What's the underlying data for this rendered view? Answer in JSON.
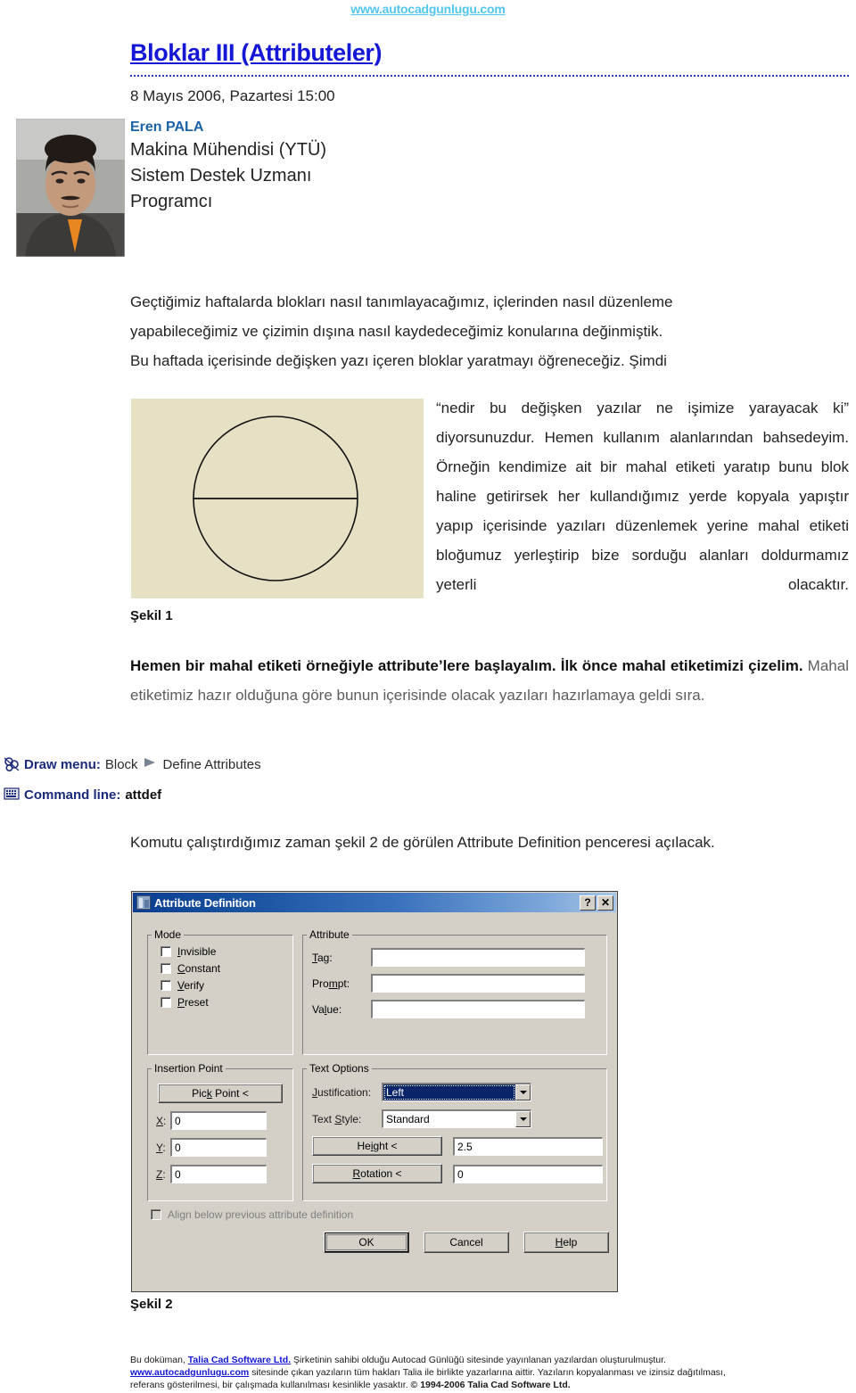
{
  "header": {
    "site_url": "www.autocadgunlugu.com",
    "title": "Bloklar III (Attributeler)",
    "date": "8 Mayıs 2006, Pazartesi 15:00"
  },
  "author": {
    "name": "Eren PALA",
    "lines": [
      "Makina Mühendisi (YTÜ)",
      "Sistem Destek Uzmanı",
      "Programcı"
    ]
  },
  "body": {
    "p1_l1": "Geçtiğimiz haftalarda blokları nasıl tanımlayacağımız, içlerinden nasıl düzenleme",
    "p1_l2": "yapabileceğimiz ve çizimin dışına nasıl kaydedeceğimiz konularına değinmiştik.",
    "p1_l3": "Bu haftada içerisinde değişken yazı içeren bloklar yaratmayı öğreneceğiz. Şimdi",
    "fig1_text": "“nedir bu değişken yazılar ne işimize yarayacak ki” diyorsunuzdur. Hemen kullanım alanlarından bahsedeyim. Örneğin kendimize ait bir mahal etiketi yaratıp bunu blok haline getirirsek her kullandığımız yerde kopyala yapıştır yapıp içerisinde yazıları düzenlemek yerine mahal etiketi bloğumuz yerleştirip bize sorduğu alanları doldurmamız yeterli olacaktır.",
    "p2_a": "Hemen bir mahal etiketi örneğiyle attribute’lere başlayalım. İlk önce mahal",
    "p2_b": "etiketimizi çizelim.",
    "p2_c": " Mahal etiketimiz hazır olduğuna göre bunun içerisinde olacak yazıları hazırlamaya geldi sıra.",
    "p3": "Komutu çalıştırdığımız zaman şekil 2 de görülen Attribute Definition penceresi açılacak."
  },
  "figures": {
    "fig1_caption": "Şekil 1",
    "fig2_caption": "Şekil 2"
  },
  "menu_paths": [
    {
      "icon": "block-define-attributes-icon",
      "label": "Draw menu:",
      "item1": "Block",
      "arrow": "arrow-right-icon",
      "item2": "Define Attributes"
    },
    {
      "icon": "keyboard-icon",
      "label": "Command line:",
      "command": "attdef"
    }
  ],
  "dialog": {
    "title": "Attribute Definition",
    "title_icon": "dialog-window-icon",
    "help_button": "?",
    "close_button": "✕",
    "mode": {
      "legend": "Mode",
      "checkboxes": [
        {
          "label_pre": "",
          "accel": "I",
          "label_post": "nvisible",
          "checked": false
        },
        {
          "label_pre": "",
          "accel": "C",
          "label_post": "onstant",
          "checked": false
        },
        {
          "label_pre": "",
          "accel": "V",
          "label_post": "erify",
          "checked": false
        },
        {
          "label_pre": "",
          "accel": "P",
          "label_post": "reset",
          "checked": false
        }
      ]
    },
    "attribute": {
      "legend": "Attribute",
      "fields": [
        {
          "label_pre": "",
          "accel": "T",
          "label_post": "ag:",
          "value": ""
        },
        {
          "label_pre": "Pro",
          "accel": "m",
          "label_post": "pt:",
          "value": ""
        },
        {
          "label_pre": "Va",
          "accel": "l",
          "label_post": "ue:",
          "value": ""
        }
      ]
    },
    "insertion_point": {
      "legend": "Insertion Point",
      "pick_point_pre": "Pic",
      "pick_point_accel": "k",
      "pick_point_post": " Point <",
      "coords": [
        {
          "accel": "X",
          "label_post": ":",
          "value": "0"
        },
        {
          "accel": "Y",
          "label_post": ":",
          "value": "0"
        },
        {
          "accel": "Z",
          "label_post": ":",
          "value": "0"
        }
      ]
    },
    "text_options": {
      "legend": "Text Options",
      "justification_label_pre": "",
      "justification_accel": "J",
      "justification_label_post": "ustification:",
      "justification_value": "Left",
      "text_style_label_pre": "Text ",
      "text_style_accel": "S",
      "text_style_label_post": "tyle:",
      "text_style_value": "Standard",
      "height_pre": "He",
      "height_accel": "i",
      "height_post": "ght <",
      "height_value": "2.5",
      "rotation_pre": "",
      "rotation_accel": "R",
      "rotation_post": "otation <",
      "rotation_value": "0"
    },
    "align_checkbox": {
      "label_pre": "Ali",
      "accel": "g",
      "label_post": "n below previous attribute definition",
      "checked": false,
      "disabled": true
    },
    "buttons": {
      "ok": "OK",
      "cancel": "Cancel",
      "help_pre": "",
      "help_accel": "H",
      "help_post": "elp"
    }
  },
  "footer": {
    "l1_a": "Bu doküman, ",
    "l1_link": "Talia Cad Software Ltd.",
    "l1_b": " Şirketinin sahibi olduğu  Autocad Günlüğü sitesinde yayınlanan yazılardan oluşturulmuştur.",
    "l2_link": "www.autocadgunlugu.com",
    "l2_b": " sitesinde çıkan yazıların tüm hakları Talia ile birlikte yazarlarına aittir. Yazıların kopyalanması ve izinsiz dağıtılması,",
    "l3_a": "referans gösterilmesi, bir çalışmada kullanılması kesinlikle yasaktır. ",
    "l3_b": "© 1994-2006 Talia Cad Software Ltd."
  },
  "colors": {
    "title_blue": "#1417d6",
    "url_cyan": "#52c6ef",
    "author_blue": "#1b63a8",
    "menu_navy": "#1b2a7a",
    "figure_bg": "#e6e0c4",
    "dialog_face": "#d4d0c8",
    "titlebar_blue": "#0b3d91",
    "select_blue": "#0a246a"
  }
}
